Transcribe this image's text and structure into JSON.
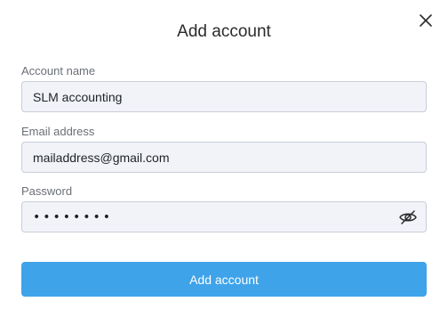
{
  "dialog": {
    "title": "Add account",
    "close_icon": "close-icon"
  },
  "fields": {
    "account_name": {
      "label": "Account name",
      "value": "SLM accounting"
    },
    "email": {
      "label": "Email address",
      "value": "mailaddress@gmail.com"
    },
    "password": {
      "label": "Password",
      "masked_value": "••••••••",
      "visibility_icon": "eye-slash-icon"
    }
  },
  "actions": {
    "submit_label": "Add account"
  },
  "colors": {
    "primary": "#3fa3ea",
    "field_bg": "#f1f3f8",
    "field_border": "#c9ced8"
  }
}
